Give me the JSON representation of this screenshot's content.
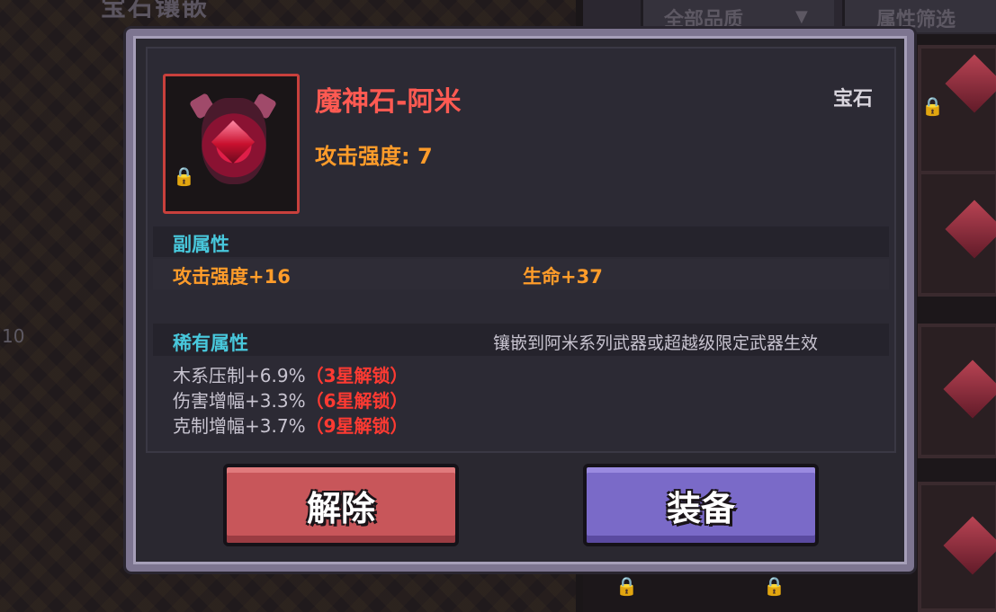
{
  "background": {
    "panel_title": "宝石镶嵌",
    "quality_filter": "全部品质",
    "attribute_filter": "属性筛选",
    "level_label": "10"
  },
  "item": {
    "name": "魔神石-阿米",
    "type": "宝石",
    "main_stat": "攻击强度: 7",
    "icon": "demon-gem-icon"
  },
  "sub_attributes": {
    "title": "副属性",
    "stats": [
      "攻击强度+16",
      "生命+37"
    ]
  },
  "rare_attributes": {
    "title": "稀有属性",
    "note": "镶嵌到阿米系列武器或超越级限定武器生效",
    "rows": [
      {
        "text": "木系压制+6.9%",
        "unlock": "（3星解锁）"
      },
      {
        "text": "伤害增幅+3.3%",
        "unlock": "（6星解锁）"
      },
      {
        "text": "克制增幅+3.7%",
        "unlock": "（9星解锁）"
      }
    ]
  },
  "buttons": {
    "remove": "解除",
    "equip": "装备"
  },
  "colors": {
    "item_name": "#ff5a52",
    "stat": "#ff9c2a",
    "section_title": "#48c8dc",
    "unlock": "#ff3a32",
    "remove_button": "#c8565a",
    "equip_button": "#7a6ac8"
  }
}
